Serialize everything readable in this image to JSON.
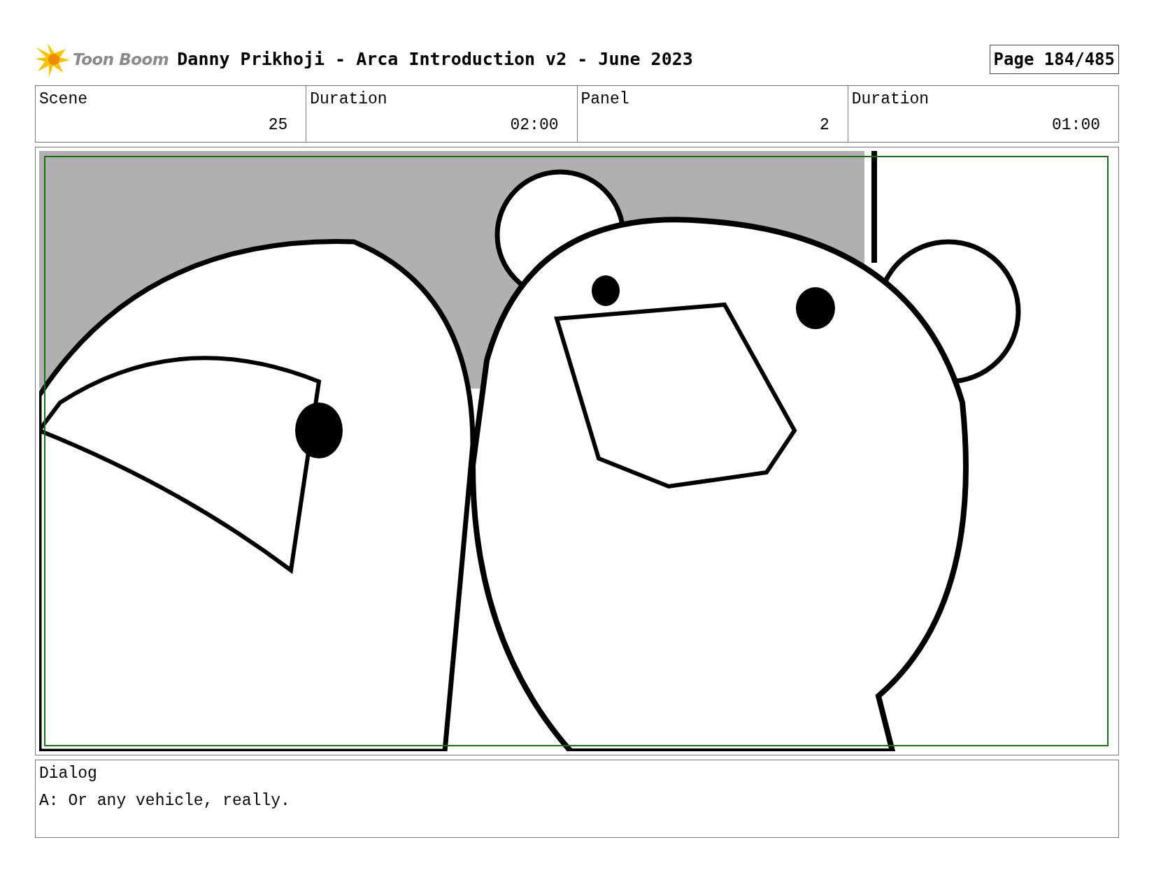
{
  "header": {
    "logo_text": "Toon Boom",
    "title": "Danny Prikhoji - Arca Introduction v2 - June 2023",
    "page": "Page 184/485"
  },
  "fields": [
    {
      "label": "Scene",
      "value": "25"
    },
    {
      "label": "Duration",
      "value": "02:00"
    },
    {
      "label": "Panel",
      "value": "2"
    },
    {
      "label": "Duration",
      "value": "01:00"
    }
  ],
  "dialog": {
    "label": "Dialog",
    "text": "A: Or any vehicle, really."
  }
}
